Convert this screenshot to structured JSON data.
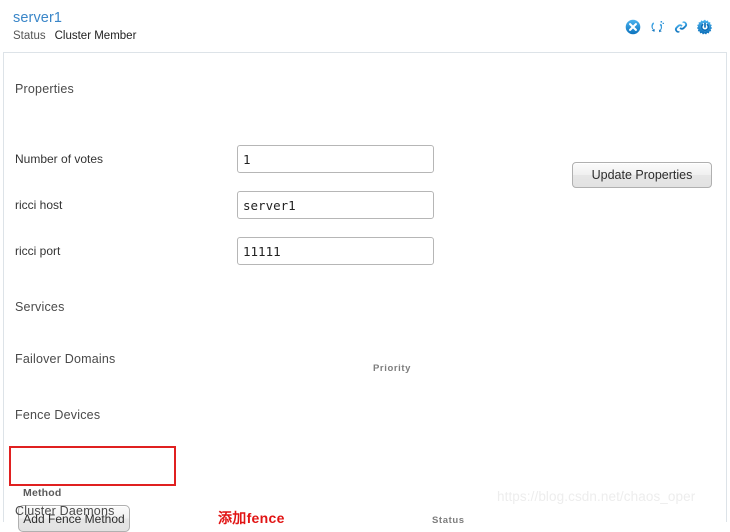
{
  "header": {
    "node_name": "server1",
    "status_label": "Status",
    "status_value": "Cluster Member",
    "actions": [
      {
        "name": "leave-cluster-icon",
        "title": "Leave Cluster"
      },
      {
        "name": "rejoin-cluster-icon",
        "title": "Join Cluster"
      },
      {
        "name": "link-icon",
        "title": "Link"
      },
      {
        "name": "reboot-icon",
        "title": "Reboot"
      }
    ],
    "accent_color": "#3a86c8",
    "icon_color": "#1e8ad6"
  },
  "properties": {
    "section_title": "Properties",
    "update_button_label": "Update Properties",
    "fields": [
      {
        "label": "Number of votes",
        "value": "1",
        "placeholder": ""
      },
      {
        "label": "ricci host",
        "value": "server1",
        "placeholder": ""
      },
      {
        "label": "ricci port",
        "value": "11111",
        "placeholder": ""
      }
    ]
  },
  "services": {
    "section_title": "Services"
  },
  "failover_domains": {
    "section_title": "Failover Domains",
    "column_header_priority": "Priority"
  },
  "fence_devices": {
    "section_title": "Fence Devices",
    "method_group_label": "Method",
    "add_fence_method_label": "Add Fence Method",
    "annotation": "添加fence",
    "annotation_color": "#e11414",
    "highlight_color": "#e02020"
  },
  "cluster_daemons": {
    "section_title": "Cluster Daemons",
    "column_header_status": "Status"
  },
  "watermark": {
    "text": "https://blog.csdn.net/chaos_oper"
  }
}
